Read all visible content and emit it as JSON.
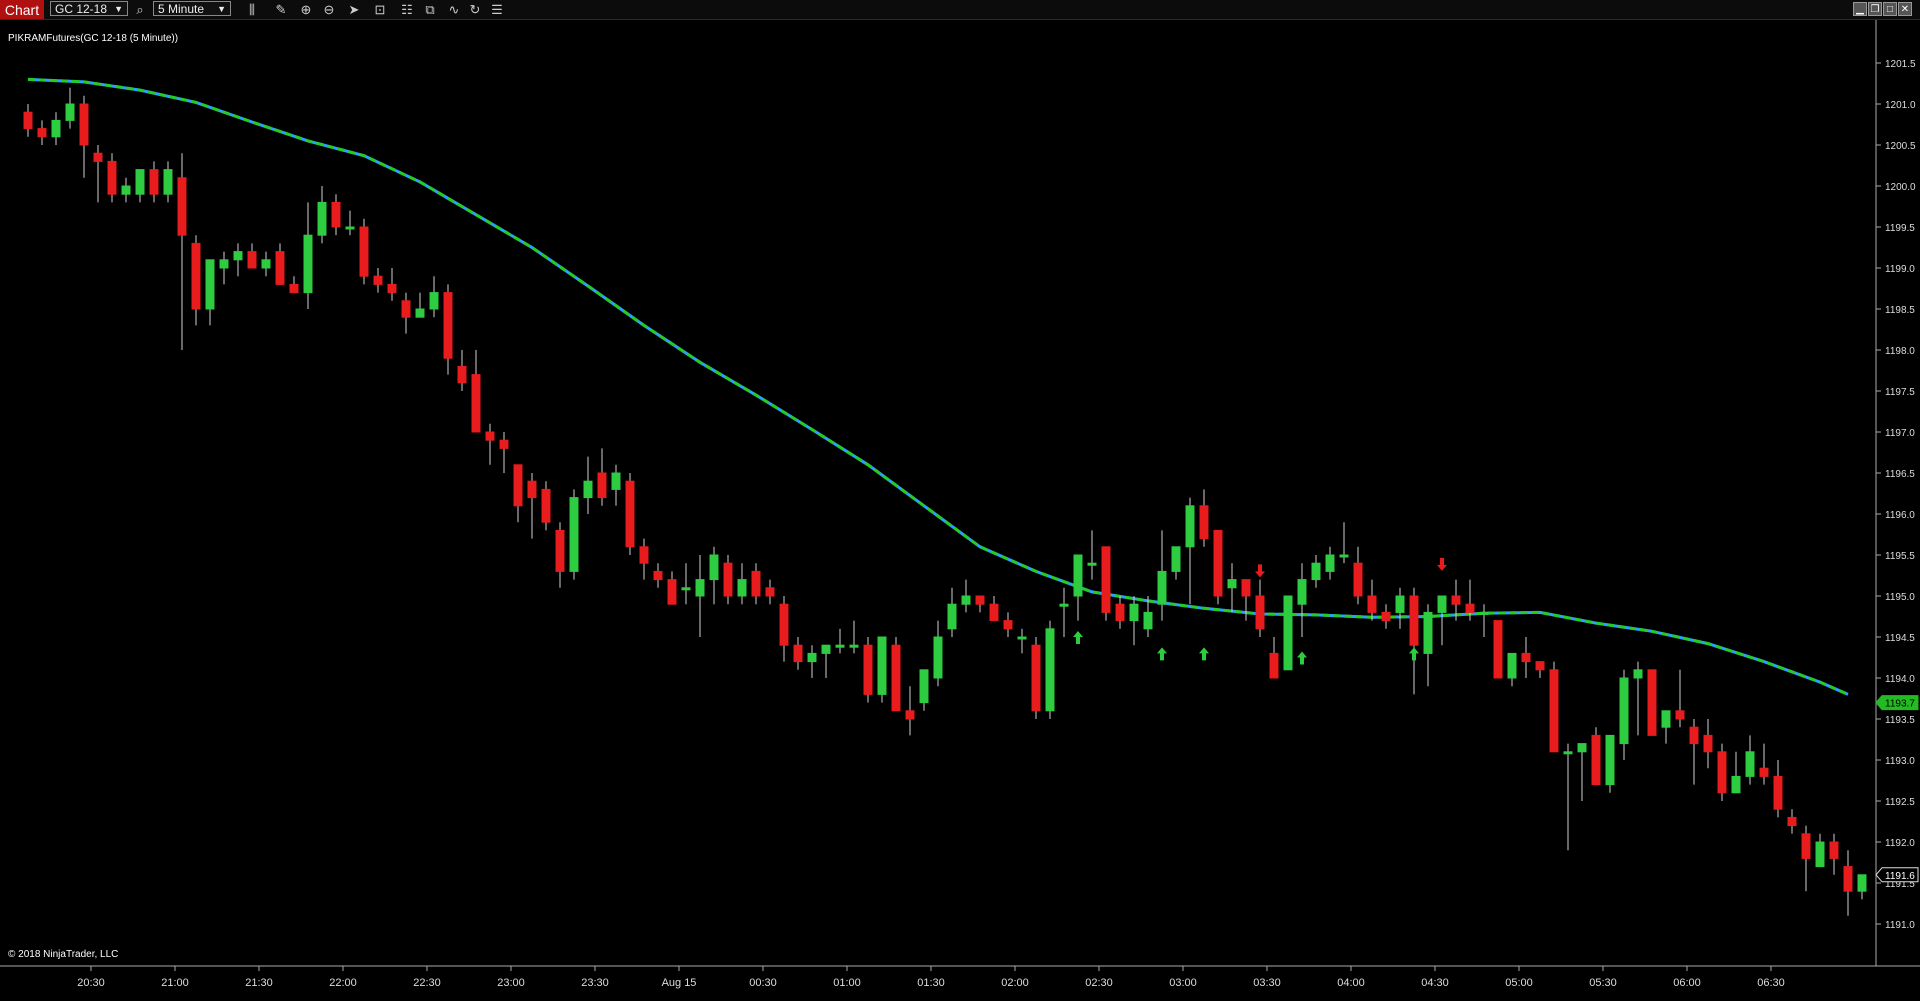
{
  "toolbar": {
    "chart_tab": "Chart",
    "instrument": "GC 12-18",
    "interval": "5 Minute",
    "icons": [
      "search-icon",
      "bar-type-icon",
      "pencil-icon",
      "zoom-in-icon",
      "zoom-out-icon",
      "pointer-icon",
      "data-box-icon",
      "layout-icon",
      "strategies-icon",
      "indicators-icon",
      "refresh-icon",
      "properties-icon"
    ],
    "window_buttons": [
      "minimize",
      "restore",
      "maximize",
      "close"
    ]
  },
  "chart": {
    "label": "PIKRAMFutures(GC 12-18 (5 Minute))",
    "copyright": "© 2018 NinjaTrader, LLC"
  },
  "colors": {
    "up": "#2ecc40",
    "down": "#e81c1c",
    "ma_primary": "#22cc22",
    "ma_secondary": "#2aa0ff",
    "background": "#000000",
    "price_marker_ma": "#22bb22"
  },
  "chart_data": {
    "type": "candlestick",
    "title": "PIKRAMFutures(GC 12-18 (5 Minute))",
    "xlabel": "",
    "ylabel": "",
    "ylim": [
      1190.5,
      1201.8
    ],
    "y_ticks": [
      "1201.5",
      "1201.0",
      "1200.5",
      "1200.0",
      "1199.5",
      "1199.0",
      "1198.5",
      "1198.0",
      "1197.5",
      "1197.0",
      "1196.5",
      "1196.0",
      "1195.5",
      "1195.0",
      "1194.5",
      "1194.0",
      "1193.5",
      "1193.0",
      "1192.5",
      "1192.0",
      "1191.5",
      "1191.0"
    ],
    "x_ticks": [
      {
        "label": "20:30",
        "bar": 5
      },
      {
        "label": "21:00",
        "bar": 11
      },
      {
        "label": "21:30",
        "bar": 17
      },
      {
        "label": "22:00",
        "bar": 23
      },
      {
        "label": "22:30",
        "bar": 29
      },
      {
        "label": "23:00",
        "bar": 35
      },
      {
        "label": "23:30",
        "bar": 41
      },
      {
        "label": "Aug 15",
        "bar": 47
      },
      {
        "label": "00:30",
        "bar": 53
      },
      {
        "label": "01:00",
        "bar": 59
      },
      {
        "label": "01:30",
        "bar": 65
      },
      {
        "label": "02:00",
        "bar": 71
      },
      {
        "label": "02:30",
        "bar": 77
      },
      {
        "label": "03:00",
        "bar": 83
      },
      {
        "label": "03:30",
        "bar": 89
      },
      {
        "label": "04:00",
        "bar": 95
      },
      {
        "label": "04:30",
        "bar": 101
      },
      {
        "label": "05:00",
        "bar": 107
      },
      {
        "label": "05:30",
        "bar": 113
      },
      {
        "label": "06:00",
        "bar": 119
      },
      {
        "label": "06:30",
        "bar": 125
      }
    ],
    "candles": [
      [
        1200.9,
        1201.0,
        1200.6,
        1200.7
      ],
      [
        1200.7,
        1200.8,
        1200.5,
        1200.6
      ],
      [
        1200.6,
        1200.9,
        1200.5,
        1200.8
      ],
      [
        1200.8,
        1201.2,
        1200.7,
        1201.0
      ],
      [
        1201.0,
        1201.1,
        1200.1,
        1200.5
      ],
      [
        1200.4,
        1200.5,
        1199.8,
        1200.3
      ],
      [
        1200.3,
        1200.4,
        1199.8,
        1199.9
      ],
      [
        1199.9,
        1200.1,
        1199.8,
        1200.0
      ],
      [
        1199.9,
        1200.2,
        1199.8,
        1200.2
      ],
      [
        1200.2,
        1200.3,
        1199.8,
        1199.9
      ],
      [
        1199.9,
        1200.3,
        1199.8,
        1200.2
      ],
      [
        1200.1,
        1200.4,
        1198.0,
        1199.4
      ],
      [
        1199.3,
        1199.4,
        1198.3,
        1198.5
      ],
      [
        1198.5,
        1199.1,
        1198.3,
        1199.1
      ],
      [
        1199.0,
        1199.2,
        1198.8,
        1199.1
      ],
      [
        1199.1,
        1199.3,
        1198.9,
        1199.2
      ],
      [
        1199.2,
        1199.3,
        1199.0,
        1199.0
      ],
      [
        1199.0,
        1199.2,
        1198.9,
        1199.1
      ],
      [
        1199.2,
        1199.3,
        1198.8,
        1198.8
      ],
      [
        1198.8,
        1198.9,
        1198.7,
        1198.7
      ],
      [
        1198.7,
        1199.8,
        1198.5,
        1199.4
      ],
      [
        1199.4,
        1200.0,
        1199.3,
        1199.8
      ],
      [
        1199.8,
        1199.9,
        1199.4,
        1199.5
      ],
      [
        1199.5,
        1199.7,
        1199.4,
        1199.5
      ],
      [
        1199.5,
        1199.6,
        1198.8,
        1198.9
      ],
      [
        1198.9,
        1199.0,
        1198.7,
        1198.8
      ],
      [
        1198.8,
        1199.0,
        1198.6,
        1198.7
      ],
      [
        1198.6,
        1198.7,
        1198.2,
        1198.4
      ],
      [
        1198.4,
        1198.7,
        1198.4,
        1198.5
      ],
      [
        1198.5,
        1198.9,
        1198.4,
        1198.7
      ],
      [
        1198.7,
        1198.8,
        1197.7,
        1197.9
      ],
      [
        1197.8,
        1198.0,
        1197.5,
        1197.6
      ],
      [
        1197.7,
        1198.0,
        1197.3,
        1197.0
      ],
      [
        1197.0,
        1197.1,
        1196.6,
        1196.9
      ],
      [
        1196.9,
        1197.0,
        1196.5,
        1196.8
      ],
      [
        1196.6,
        1196.6,
        1195.9,
        1196.1
      ],
      [
        1196.4,
        1196.5,
        1195.7,
        1196.2
      ],
      [
        1196.3,
        1196.4,
        1195.8,
        1195.9
      ],
      [
        1195.8,
        1195.9,
        1195.1,
        1195.3
      ],
      [
        1195.3,
        1196.3,
        1195.2,
        1196.2
      ],
      [
        1196.2,
        1196.7,
        1196.0,
        1196.4
      ],
      [
        1196.5,
        1196.8,
        1196.1,
        1196.2
      ],
      [
        1196.3,
        1196.6,
        1196.1,
        1196.5
      ],
      [
        1196.4,
        1196.5,
        1195.5,
        1195.6
      ],
      [
        1195.6,
        1195.7,
        1195.2,
        1195.4
      ],
      [
        1195.3,
        1195.4,
        1195.1,
        1195.2
      ],
      [
        1195.2,
        1195.3,
        1194.9,
        1194.9
      ],
      [
        1195.1,
        1195.4,
        1194.9,
        1195.1
      ],
      [
        1195.0,
        1195.5,
        1194.5,
        1195.2
      ],
      [
        1195.2,
        1195.6,
        1194.9,
        1195.5
      ],
      [
        1195.4,
        1195.5,
        1194.9,
        1195.0
      ],
      [
        1195.0,
        1195.4,
        1194.9,
        1195.2
      ],
      [
        1195.3,
        1195.4,
        1194.9,
        1195.0
      ],
      [
        1195.1,
        1195.2,
        1194.9,
        1195.0
      ],
      [
        1194.9,
        1195.0,
        1194.2,
        1194.4
      ],
      [
        1194.4,
        1194.5,
        1194.1,
        1194.2
      ],
      [
        1194.2,
        1194.4,
        1194.0,
        1194.3
      ],
      [
        1194.3,
        1194.4,
        1194.0,
        1194.4
      ],
      [
        1194.4,
        1194.6,
        1194.3,
        1194.4
      ],
      [
        1194.4,
        1194.7,
        1194.3,
        1194.4
      ],
      [
        1194.4,
        1194.5,
        1193.7,
        1193.8
      ],
      [
        1193.8,
        1194.5,
        1193.7,
        1194.5
      ],
      [
        1194.4,
        1194.5,
        1193.6,
        1193.6
      ],
      [
        1193.6,
        1193.9,
        1193.3,
        1193.5
      ],
      [
        1193.7,
        1194.1,
        1193.6,
        1194.1
      ],
      [
        1194.0,
        1194.7,
        1193.9,
        1194.5
      ],
      [
        1194.6,
        1195.1,
        1194.5,
        1194.9
      ],
      [
        1194.9,
        1195.2,
        1194.8,
        1195.0
      ],
      [
        1195.0,
        1195.0,
        1194.8,
        1194.9
      ],
      [
        1194.9,
        1195.0,
        1194.7,
        1194.7
      ],
      [
        1194.7,
        1194.8,
        1194.5,
        1194.6
      ],
      [
        1194.5,
        1194.6,
        1194.3,
        1194.5
      ],
      [
        1194.4,
        1194.5,
        1193.5,
        1193.6
      ],
      [
        1193.6,
        1194.7,
        1193.5,
        1194.6
      ],
      [
        1194.9,
        1195.1,
        1194.5,
        1194.9
      ],
      [
        1195.0,
        1195.5,
        1194.7,
        1195.5
      ],
      [
        1195.4,
        1195.8,
        1195.2,
        1195.4
      ],
      [
        1195.6,
        1195.6,
        1194.7,
        1194.8
      ],
      [
        1194.9,
        1195.0,
        1194.6,
        1194.7
      ],
      [
        1194.7,
        1195.0,
        1194.4,
        1194.9
      ],
      [
        1194.6,
        1195.0,
        1194.5,
        1194.8
      ],
      [
        1194.9,
        1195.8,
        1194.7,
        1195.3
      ],
      [
        1195.3,
        1195.6,
        1195.2,
        1195.6
      ],
      [
        1195.6,
        1196.2,
        1194.9,
        1196.1
      ],
      [
        1196.1,
        1196.3,
        1195.6,
        1195.7
      ],
      [
        1195.8,
        1195.8,
        1194.9,
        1195.0
      ],
      [
        1195.1,
        1195.4,
        1194.8,
        1195.2
      ],
      [
        1195.2,
        1195.2,
        1194.7,
        1195.0
      ],
      [
        1195.0,
        1195.2,
        1194.5,
        1194.6
      ],
      [
        1194.3,
        1194.5,
        1194.0,
        1194.0
      ],
      [
        1194.1,
        1195.0,
        1194.1,
        1195.0
      ],
      [
        1194.9,
        1195.4,
        1194.5,
        1195.2
      ],
      [
        1195.2,
        1195.5,
        1195.1,
        1195.4
      ],
      [
        1195.3,
        1195.6,
        1195.2,
        1195.5
      ],
      [
        1195.5,
        1195.9,
        1195.4,
        1195.5
      ],
      [
        1195.4,
        1195.6,
        1194.9,
        1195.0
      ],
      [
        1195.0,
        1195.2,
        1194.7,
        1194.8
      ],
      [
        1194.8,
        1194.9,
        1194.6,
        1194.7
      ],
      [
        1194.8,
        1195.1,
        1194.6,
        1195.0
      ],
      [
        1195.0,
        1195.1,
        1193.8,
        1194.4
      ],
      [
        1194.3,
        1194.9,
        1193.9,
        1194.8
      ],
      [
        1194.8,
        1195.0,
        1194.4,
        1195.0
      ],
      [
        1195.0,
        1195.2,
        1194.7,
        1194.9
      ],
      [
        1194.9,
        1195.2,
        1194.7,
        1194.8
      ],
      [
        1194.8,
        1194.9,
        1194.5,
        1194.8
      ],
      [
        1194.7,
        1194.7,
        1194.0,
        1194.0
      ],
      [
        1194.0,
        1194.3,
        1193.9,
        1194.3
      ],
      [
        1194.3,
        1194.5,
        1194.0,
        1194.2
      ],
      [
        1194.2,
        1194.2,
        1194.0,
        1194.1
      ],
      [
        1194.1,
        1194.2,
        1193.1,
        1193.1
      ],
      [
        1193.1,
        1193.2,
        1191.9,
        1193.1
      ],
      [
        1193.1,
        1193.2,
        1192.5,
        1193.2
      ],
      [
        1193.3,
        1193.4,
        1192.8,
        1192.7
      ],
      [
        1192.7,
        1193.3,
        1192.6,
        1193.3
      ],
      [
        1193.2,
        1194.1,
        1193.0,
        1194.0
      ],
      [
        1194.0,
        1194.2,
        1193.3,
        1194.1
      ],
      [
        1194.1,
        1194.1,
        1193.3,
        1193.3
      ],
      [
        1193.4,
        1193.6,
        1193.2,
        1193.6
      ],
      [
        1193.6,
        1194.1,
        1193.4,
        1193.5
      ],
      [
        1193.4,
        1193.5,
        1192.7,
        1193.2
      ],
      [
        1193.3,
        1193.5,
        1192.9,
        1193.1
      ],
      [
        1193.1,
        1193.2,
        1192.5,
        1192.6
      ],
      [
        1192.6,
        1193.1,
        1192.6,
        1192.8
      ],
      [
        1192.8,
        1193.3,
        1192.7,
        1193.1
      ],
      [
        1192.9,
        1193.2,
        1192.7,
        1192.8
      ],
      [
        1192.8,
        1193.0,
        1192.3,
        1192.4
      ],
      [
        1192.3,
        1192.4,
        1192.1,
        1192.2
      ],
      [
        1192.1,
        1192.2,
        1191.4,
        1191.8
      ],
      [
        1191.7,
        1192.1,
        1191.7,
        1192.0
      ],
      [
        1192.0,
        1192.1,
        1191.6,
        1191.8
      ],
      [
        1191.7,
        1191.9,
        1191.1,
        1191.4
      ],
      [
        1191.4,
        1191.6,
        1191.3,
        1191.6
      ]
    ],
    "moving_average": {
      "name": "",
      "style": "dash-dot",
      "points": [
        [
          0,
          1201.3
        ],
        [
          4,
          1201.27
        ],
        [
          8,
          1201.17
        ],
        [
          12,
          1201.02
        ],
        [
          16,
          1200.78
        ],
        [
          20,
          1200.55
        ],
        [
          24,
          1200.37
        ],
        [
          28,
          1200.05
        ],
        [
          32,
          1199.65
        ],
        [
          36,
          1199.25
        ],
        [
          40,
          1198.78
        ],
        [
          44,
          1198.3
        ],
        [
          48,
          1197.85
        ],
        [
          52,
          1197.45
        ],
        [
          56,
          1197.03
        ],
        [
          60,
          1196.6
        ],
        [
          64,
          1196.1
        ],
        [
          68,
          1195.6
        ],
        [
          72,
          1195.3
        ],
        [
          76,
          1195.05
        ],
        [
          80,
          1194.94
        ],
        [
          84,
          1194.85
        ],
        [
          88,
          1194.78
        ],
        [
          92,
          1194.77
        ],
        [
          96,
          1194.74
        ],
        [
          100,
          1194.75
        ],
        [
          104,
          1194.79
        ],
        [
          108,
          1194.8
        ],
        [
          112,
          1194.67
        ],
        [
          116,
          1194.57
        ],
        [
          120,
          1194.42
        ],
        [
          124,
          1194.2
        ],
        [
          128,
          1193.95
        ],
        [
          130,
          1193.8
        ]
      ]
    },
    "signals": [
      {
        "bar": 75,
        "dir": "up",
        "price": 1194.5
      },
      {
        "bar": 81,
        "dir": "up",
        "price": 1194.3
      },
      {
        "bar": 84,
        "dir": "up",
        "price": 1194.3
      },
      {
        "bar": 88,
        "dir": "down",
        "price": 1195.3
      },
      {
        "bar": 91,
        "dir": "up",
        "price": 1194.25
      },
      {
        "bar": 99,
        "dir": "up",
        "price": 1194.3
      },
      {
        "bar": 101,
        "dir": "down",
        "price": 1195.38
      }
    ],
    "price_markers": [
      {
        "label": "1193.7",
        "value": 1193.7,
        "kind": "ma"
      },
      {
        "label": "1191.6",
        "value": 1191.6,
        "kind": "last"
      }
    ]
  }
}
